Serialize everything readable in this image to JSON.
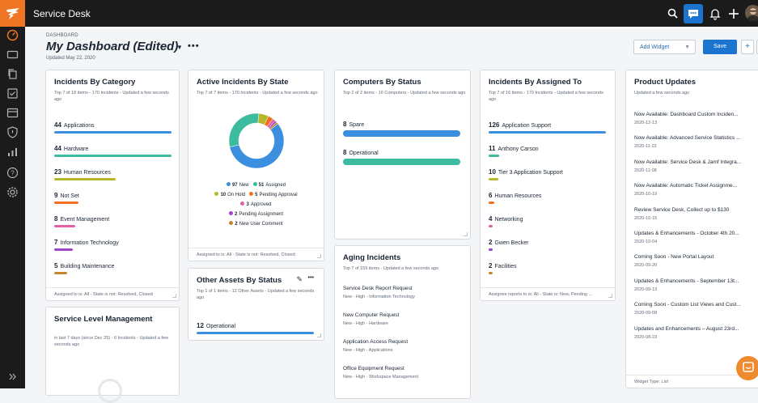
{
  "app": {
    "title": "Service Desk"
  },
  "header": {
    "breadcrumb": "DASHBOARD",
    "title": "My Dashboard (Edited)",
    "updated": "Updated May 22, 2020",
    "add_widget": "Add Widget",
    "save": "Save",
    "more": "•••"
  },
  "colors": {
    "accent": "#1b75d0",
    "logo": "#ef7423",
    "topbar": "#1b1b1b"
  },
  "incidents_by_category": {
    "title": "Incidents By Category",
    "subtitle": "Top 7 of 18 items - 170 Incidents - Updated a few seconds ago",
    "rows": [
      {
        "count": "44",
        "label": "Applications",
        "value": 44,
        "color": "#3b8fde"
      },
      {
        "count": "44",
        "label": "Hardware",
        "value": 44,
        "color": "#3dbb9f"
      },
      {
        "count": "23",
        "label": "Human Resources",
        "value": 23,
        "color": "#b5b82b"
      },
      {
        "count": "9",
        "label": "Not Set",
        "value": 9,
        "color": "#f26f21"
      },
      {
        "count": "8",
        "label": "Event Management",
        "value": 8,
        "color": "#e35fa8"
      },
      {
        "count": "7",
        "label": "Information Technology",
        "value": 7,
        "color": "#9b46c9"
      },
      {
        "count": "5",
        "label": "Building Maintenance",
        "value": 5,
        "color": "#c4872e"
      }
    ],
    "footer": "Assigned to is: All - State is not: Resolved, Closed"
  },
  "active_incidents": {
    "title": "Active Incidents By State",
    "subtitle": "Top 7 of 7 items - 170 Incidents - Updated a few seconds ago",
    "legend": [
      {
        "count": "97",
        "label": "New",
        "value": 97,
        "color": "#3b8fde"
      },
      {
        "count": "51",
        "label": "Assigned",
        "value": 51,
        "color": "#3dbb9f"
      },
      {
        "count": "10",
        "label": "On Hold",
        "value": 10,
        "color": "#b5b82b"
      },
      {
        "count": "5",
        "label": "Pending Approval",
        "value": 5,
        "color": "#f26f21"
      },
      {
        "count": "3",
        "label": "Approved",
        "value": 3,
        "color": "#e35fa8"
      },
      {
        "count": "2",
        "label": "Pending Assignment",
        "value": 2,
        "color": "#9b46c9"
      },
      {
        "count": "2",
        "label": "New User Comment",
        "value": 2,
        "color": "#c4872e"
      }
    ],
    "footer": "Assigned to is: All - State is not: Resolved, Closed"
  },
  "computers": {
    "title": "Computers By Status",
    "subtitle": "Top 2 of 2 items - 16 Computers - Updated a few seconds ago",
    "rows": [
      {
        "count": "8",
        "label": "Spare",
        "value": 8,
        "color": "#3b8fde"
      },
      {
        "count": "8",
        "label": "Operational",
        "value": 8,
        "color": "#3dbb9f"
      }
    ]
  },
  "aging": {
    "title": "Aging Incidents",
    "subtitle": "Top 7 of 159 items - Updated a few seconds ago",
    "items": [
      {
        "title": "Service Desk Report Request",
        "sub": "New - High - Information Technology"
      },
      {
        "title": "New Computer Request",
        "sub": "New - High - Hardware"
      },
      {
        "title": "Application Access Request",
        "sub": "New - High - Applications"
      },
      {
        "title": "Office Equipment Request",
        "sub": "New - High - Workspace Management"
      }
    ]
  },
  "other_assets": {
    "title": "Other Assets By Status",
    "subtitle": "Top 1 of 1 items - 12 Other Assets - Updated a few seconds ago",
    "rows": [
      {
        "count": "12",
        "label": "Operational",
        "value": 12,
        "color": "#3b8fde"
      }
    ]
  },
  "assigned_to": {
    "title": "Incidents By Assigned To",
    "subtitle": "Top 7 of 16 items - 170 Incidents - Updated a few seconds ago",
    "rows": [
      {
        "count": "126",
        "label": "Application Support",
        "value": 126,
        "color": "#3b8fde"
      },
      {
        "count": "11",
        "label": "Anthony Carson",
        "value": 11,
        "color": "#3dbb9f"
      },
      {
        "count": "10",
        "label": "Tier 3 Application Support",
        "value": 10,
        "color": "#b5b82b"
      },
      {
        "count": "6",
        "label": "Human Resources",
        "value": 6,
        "color": "#f26f21"
      },
      {
        "count": "4",
        "label": "Networking",
        "value": 4,
        "color": "#e35fa8"
      },
      {
        "count": "2",
        "label": "Gwen Becker",
        "value": 2,
        "color": "#9b46c9"
      },
      {
        "count": "2",
        "label": "Facilities",
        "value": 2,
        "color": "#c4872e"
      }
    ],
    "footer": "Assignee reports to is: All - State is: New, Pending ..."
  },
  "sla": {
    "title": "Service Level Management",
    "subtitle": "in last 7 days (since Dec 25) - 0 Incidents - Updated a few seconds ago"
  },
  "product_updates": {
    "title": "Product Updates",
    "subtitle": "Updated a few seconds ago",
    "items": [
      {
        "title": "Now Available: Dashboard Custom Inciden...",
        "date": "2020-12-13"
      },
      {
        "title": "Now Available: Advanced Service Statistics ...",
        "date": "2020-11-22"
      },
      {
        "title": "Now Available: Service Desk & Jamf Integra...",
        "date": "2020-11-08"
      },
      {
        "title": "Now Available: Automatic Ticket Assignme...",
        "date": "2020-10-19"
      },
      {
        "title": "Review Service Desk, Collect up to $130",
        "date": "2020-10-15"
      },
      {
        "title": "Updates & Enhancements - October 4th 20...",
        "date": "2020-10-04"
      },
      {
        "title": "Coming Soon - New Portal Layout",
        "date": "2020-09-20"
      },
      {
        "title": "Updates & Enhancements - September 13t...",
        "date": "2020-09-13"
      },
      {
        "title": "Coming Soon - Custom List Views and Cust...",
        "date": "2020-09-08"
      },
      {
        "title": "Updates and Enhancements – August 23rd...",
        "date": "2020-08-23"
      }
    ],
    "footer": "Widget Type: List"
  }
}
